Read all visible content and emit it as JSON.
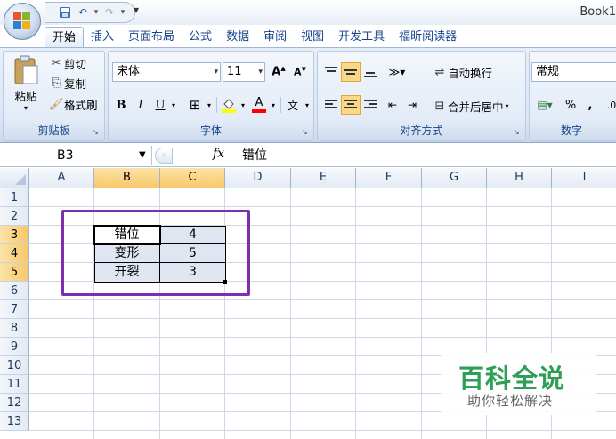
{
  "window": {
    "title": "Book1"
  },
  "quick_access": {
    "save_icon": "save-icon",
    "undo_icon": "undo-icon",
    "redo_icon": "redo-icon",
    "more_icon": "customize-qat-icon"
  },
  "tabs": [
    {
      "label": "开始",
      "active": true
    },
    {
      "label": "插入"
    },
    {
      "label": "页面布局"
    },
    {
      "label": "公式"
    },
    {
      "label": "数据"
    },
    {
      "label": "审阅"
    },
    {
      "label": "视图"
    },
    {
      "label": "开发工具"
    },
    {
      "label": "福昕阅读器"
    }
  ],
  "clipboard": {
    "paste": "粘贴",
    "cut": "剪切",
    "copy": "复制",
    "format_painter": "格式刷",
    "group_label": "剪贴板"
  },
  "font": {
    "name": "宋体",
    "size": "11",
    "bold": "B",
    "italic": "I",
    "underline": "U",
    "group_label": "字体"
  },
  "alignment": {
    "wrap_text": "自动换行",
    "merge_center": "合并后居中",
    "group_label": "对齐方式"
  },
  "number": {
    "format": "常规",
    "percent": "%",
    "comma": ",",
    "group_label": "数字"
  },
  "formula_bar": {
    "name_box": "B3",
    "fx": "fx",
    "value": "错位"
  },
  "columns": [
    "A",
    "B",
    "C",
    "D",
    "E",
    "F",
    "G",
    "H",
    "I"
  ],
  "selected_columns": [
    "B",
    "C"
  ],
  "rows": [
    "1",
    "2",
    "3",
    "4",
    "5",
    "6",
    "7",
    "8",
    "9",
    "10",
    "11",
    "12",
    "13"
  ],
  "selected_rows": [
    "3",
    "4",
    "5"
  ],
  "table": [
    {
      "label": "错位",
      "value": "4"
    },
    {
      "label": "变形",
      "value": "5"
    },
    {
      "label": "开裂",
      "value": "3"
    }
  ],
  "colors": {
    "highlight_box": "#7e2fb0",
    "selected_header": "#f8c86a",
    "ribbon_text": "#15428b"
  },
  "watermark": {
    "title": "百科全说",
    "subtitle": "助你轻松解决"
  }
}
